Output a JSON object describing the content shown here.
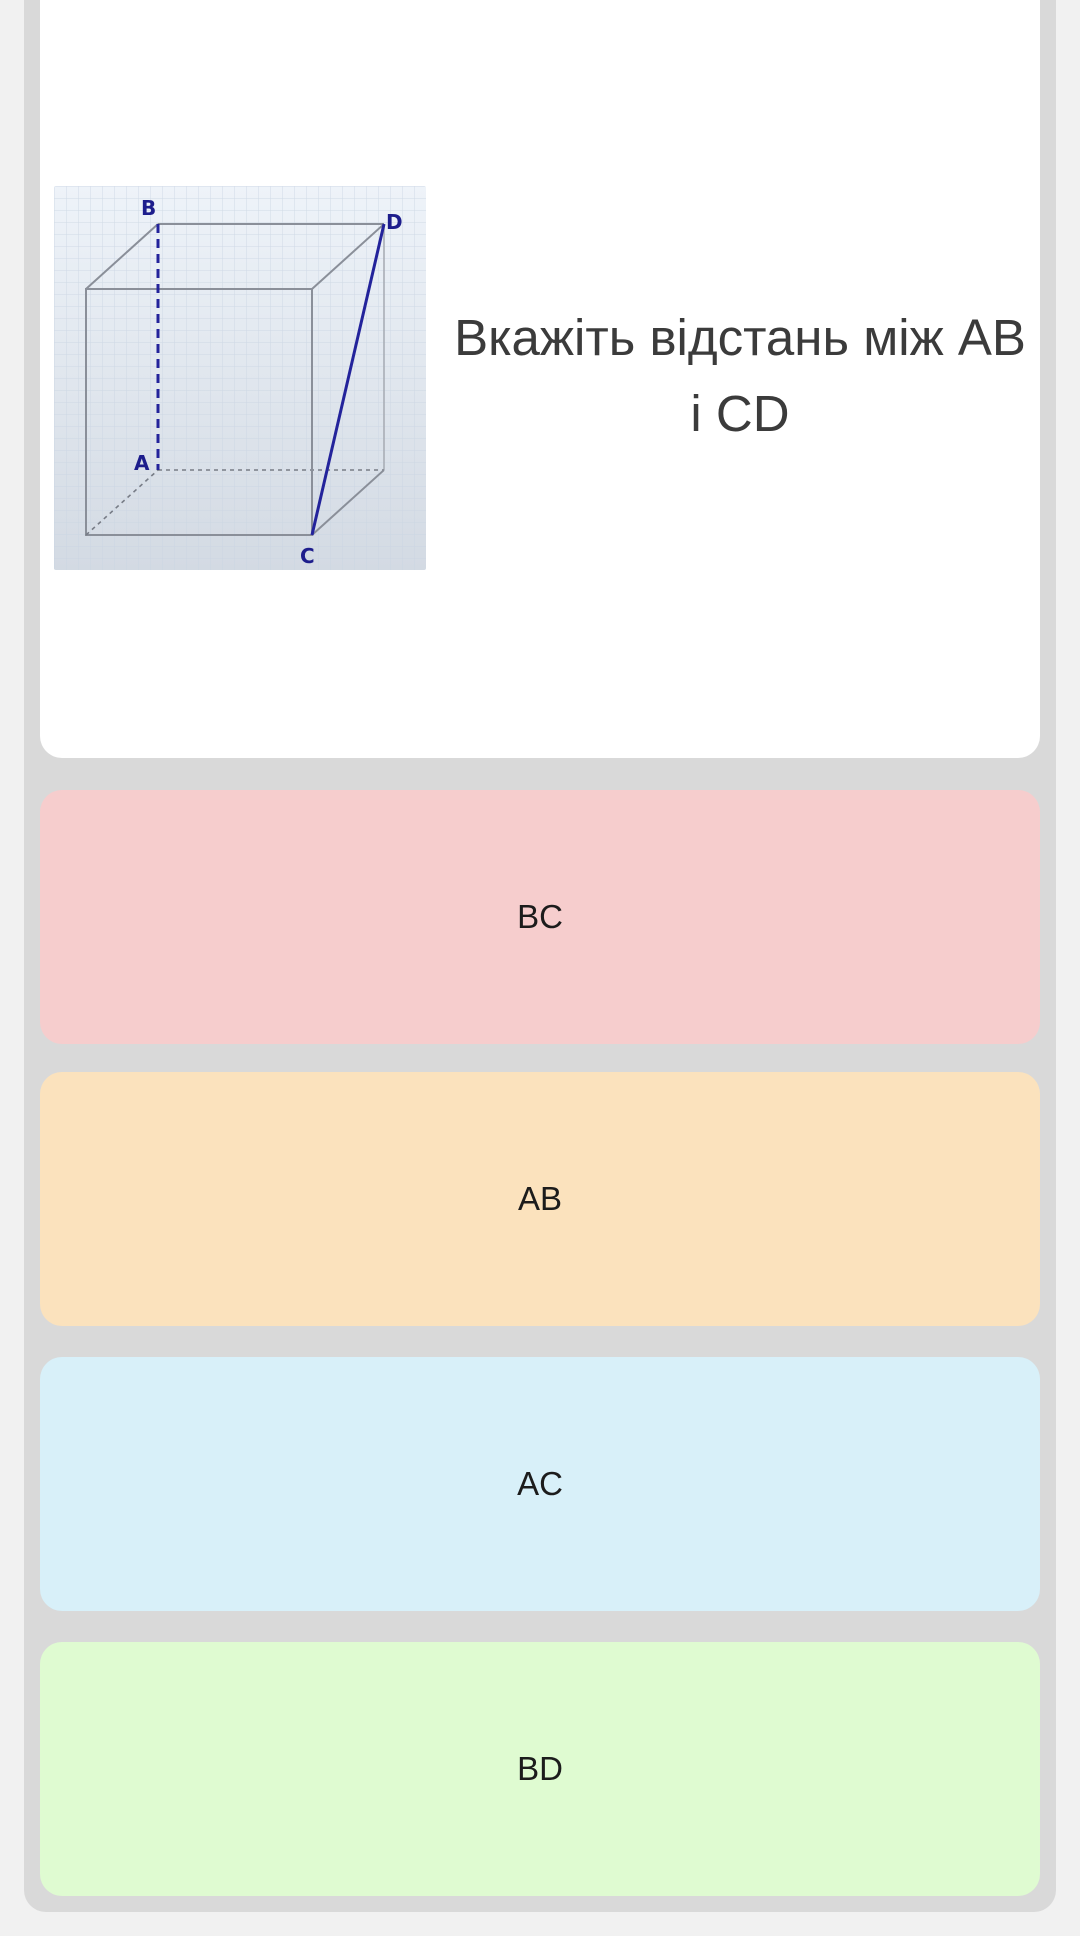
{
  "question": {
    "text": "Вкажіть відстань між AB і CD",
    "figure": {
      "labels": {
        "b": "B",
        "d": "D",
        "a": "A",
        "c": "C"
      }
    }
  },
  "answers": [
    {
      "label": "BC",
      "color": "#f6cdcd"
    },
    {
      "label": "AB",
      "color": "#fbe2bd"
    },
    {
      "label": "AC",
      "color": "#d8f0f9"
    },
    {
      "label": "BD",
      "color": "#dffbd1"
    }
  ]
}
